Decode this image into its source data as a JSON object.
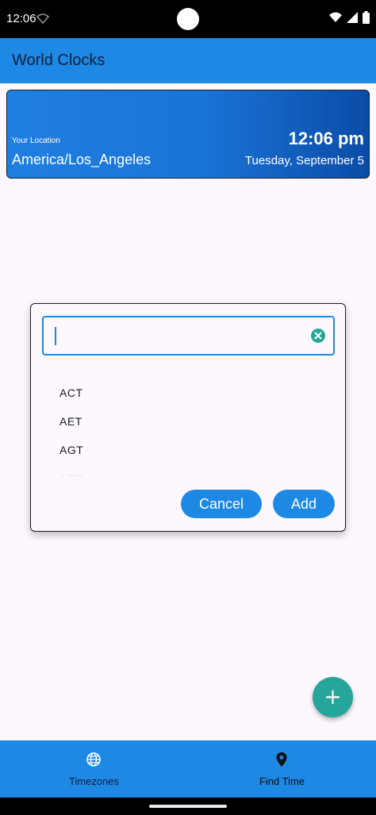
{
  "status_bar": {
    "time": "12:06"
  },
  "app_bar": {
    "title": "World Clocks"
  },
  "location_card": {
    "label": "Your Location",
    "timezone": "America/Los_Angeles",
    "time": "12:06 pm",
    "date": "Tuesday, September 5"
  },
  "dialog": {
    "search": {
      "value": "",
      "placeholder": ""
    },
    "timezones": [
      "ACT",
      "AET",
      "AGT",
      "ART"
    ],
    "cancel_label": "Cancel",
    "add_label": "Add"
  },
  "bottom_nav": {
    "items": [
      {
        "label": "Timezones",
        "icon": "globe-icon"
      },
      {
        "label": "Find Time",
        "icon": "location-pin-icon"
      }
    ]
  },
  "colors": {
    "primary": "#1e88e5",
    "fab": "#26a69a",
    "background": "#fdf8fd"
  }
}
